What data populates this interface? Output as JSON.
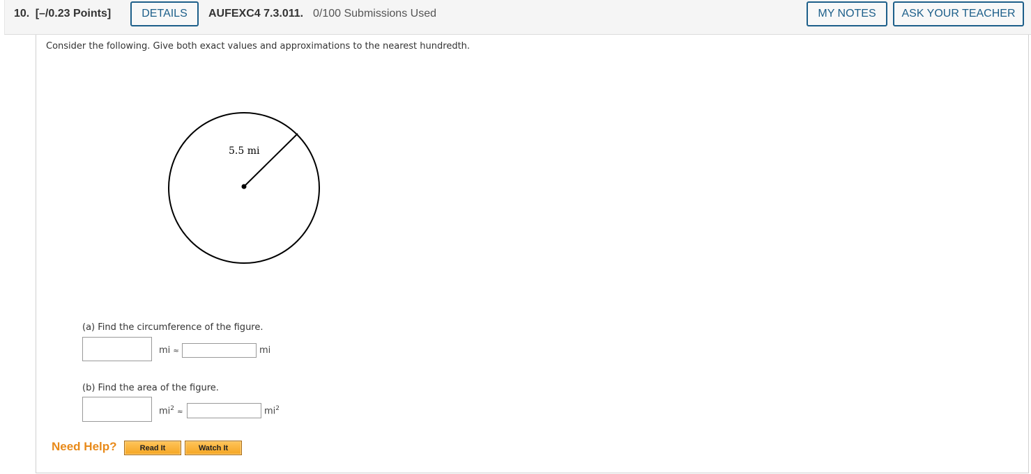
{
  "header": {
    "question_number": "10.",
    "points": "[–/0.23 Points]",
    "details_label": "DETAILS",
    "problem_code": "AUFEXC4 7.3.011.",
    "submissions": "0/100 Submissions Used",
    "my_notes_label": "MY NOTES",
    "ask_teacher_label": "ASK YOUR TEACHER"
  },
  "instructions": "Consider the following. Give both exact values and approximations to the nearest hundredth.",
  "figure": {
    "shape": "circle",
    "radius_label": "5.5 mi"
  },
  "parts": [
    {
      "label": "(a) Find the circumference of the figure.",
      "exact_value": "",
      "exact_unit": "mi",
      "approx_symbol": "≈",
      "approx_value": "",
      "approx_unit": "mi"
    },
    {
      "label": "(b) Find the area of the figure.",
      "exact_value": "",
      "exact_unit": "mi",
      "exact_unit_exp": "2",
      "approx_symbol": "≈",
      "approx_value": "",
      "approx_unit": "mi",
      "approx_unit_exp": "2"
    }
  ],
  "help": {
    "label": "Need Help?",
    "read_it": "Read It",
    "watch_it": "Watch It"
  }
}
